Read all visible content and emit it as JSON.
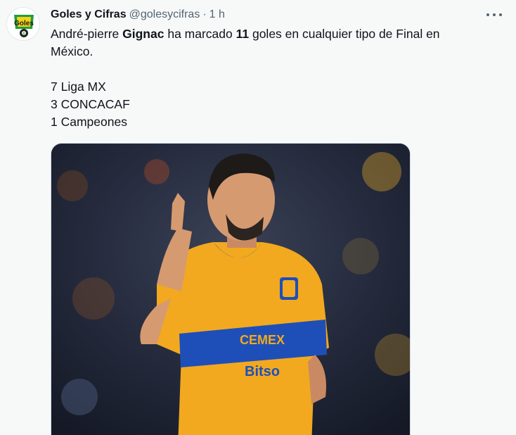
{
  "tweet": {
    "author_name": "Goles y Cifras",
    "handle": "@golesycifras",
    "separator": "·",
    "time": "1 h",
    "more_icon": "more-horizontal-icon",
    "text": {
      "line1_part1": "André-pierre ",
      "line1_bold1": "Gignac",
      "line1_part2": " ha marcado ",
      "line1_bold2": "11",
      "line1_part3": " goles en cualquier tipo de Final en",
      "line2": "México.",
      "items": [
        "7 Liga MX",
        "3 CONCACAF",
        "1 Campeones"
      ]
    },
    "media": {
      "jersey_sponsor_1": "CEMEX",
      "jersey_sponsor_2": "Bitso",
      "jersey_color": "#f2a91f",
      "stripe_color": "#1e4fb8"
    },
    "avatar": {
      "logo_top": "Goles",
      "logo_bottom": "&"
    }
  }
}
